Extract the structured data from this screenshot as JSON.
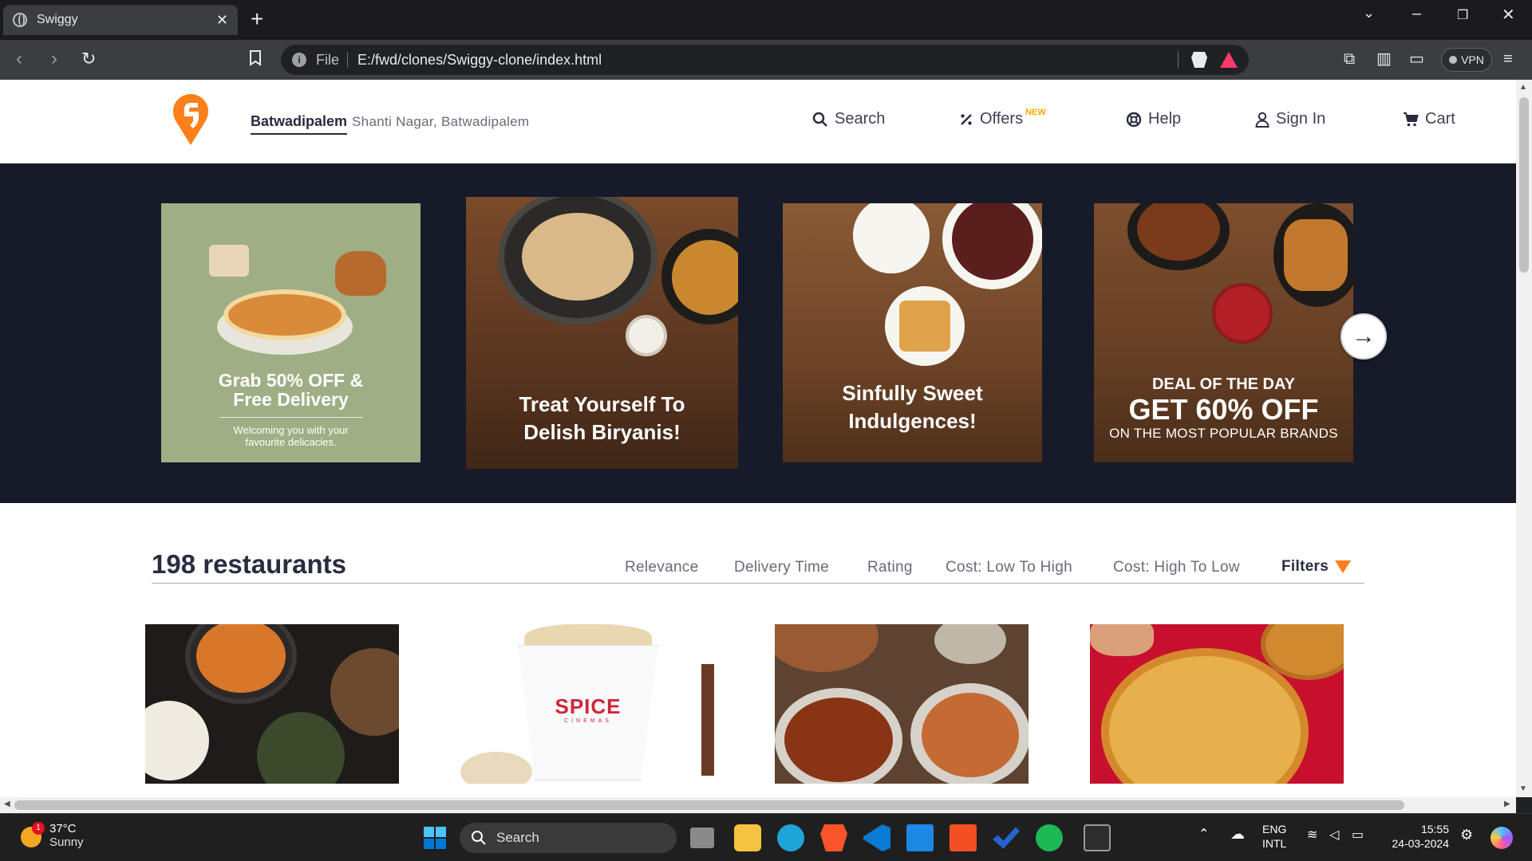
{
  "browser": {
    "tab_title": "Swiggy",
    "url_scheme": "File",
    "url": "E:/fwd/clones/Swiggy-clone/index.html",
    "vpn_label": "VPN"
  },
  "header": {
    "location_city": "Batwadipalem",
    "location_area": "Shanti Nagar, Batwadipalem",
    "nav": {
      "search": "Search",
      "offers": "Offers",
      "offers_badge": "NEW",
      "help": "Help",
      "signin": "Sign In",
      "cart": "Cart"
    }
  },
  "carousel": {
    "banner1": {
      "title_line1": "Grab 50% OFF &",
      "title_line2": "Free Delivery",
      "subtitle_line1": "Welcoming you with your",
      "subtitle_line2": "favourite delicacies."
    },
    "banner2": {
      "title_line1": "Treat Yourself To",
      "title_line2": "Delish Biryanis!"
    },
    "banner3": {
      "title_line1": "Sinfully Sweet",
      "title_line2": "Indulgences!"
    },
    "banner4": {
      "kicker": "DEAL OF THE DAY",
      "headline": "GET 60% OFF",
      "subtitle": "ON THE MOST POPULAR BRANDS"
    }
  },
  "restaurants": {
    "count_label": "198 restaurants",
    "sort_options": [
      "Relevance",
      "Delivery Time",
      "Rating",
      "Cost: Low To High",
      "Cost: High To Low"
    ],
    "filters_label": "Filters",
    "cards": [
      {
        "image": "north-indian-dishes-thumbnail"
      },
      {
        "image": "spice-cinemas-popcorn-thumbnail",
        "brand_text": "SPICE",
        "brand_sub": "CINEMAS"
      },
      {
        "image": "biryani-dishes-thumbnail"
      },
      {
        "image": "pizza-thumbnail"
      }
    ]
  },
  "taskbar": {
    "weather_temp": "37°C",
    "weather_condition": "Sunny",
    "weather_badge": "1",
    "search_label": "Search",
    "language_line1": "ENG",
    "language_line2": "INTL",
    "time": "15:55",
    "date": "24-03-2024"
  },
  "colors": {
    "brand_orange": "#fc8019",
    "carousel_bg": "#171a29",
    "text_dark": "#282c3f",
    "text_muted": "#686b78",
    "new_badge": "#ffa700"
  }
}
